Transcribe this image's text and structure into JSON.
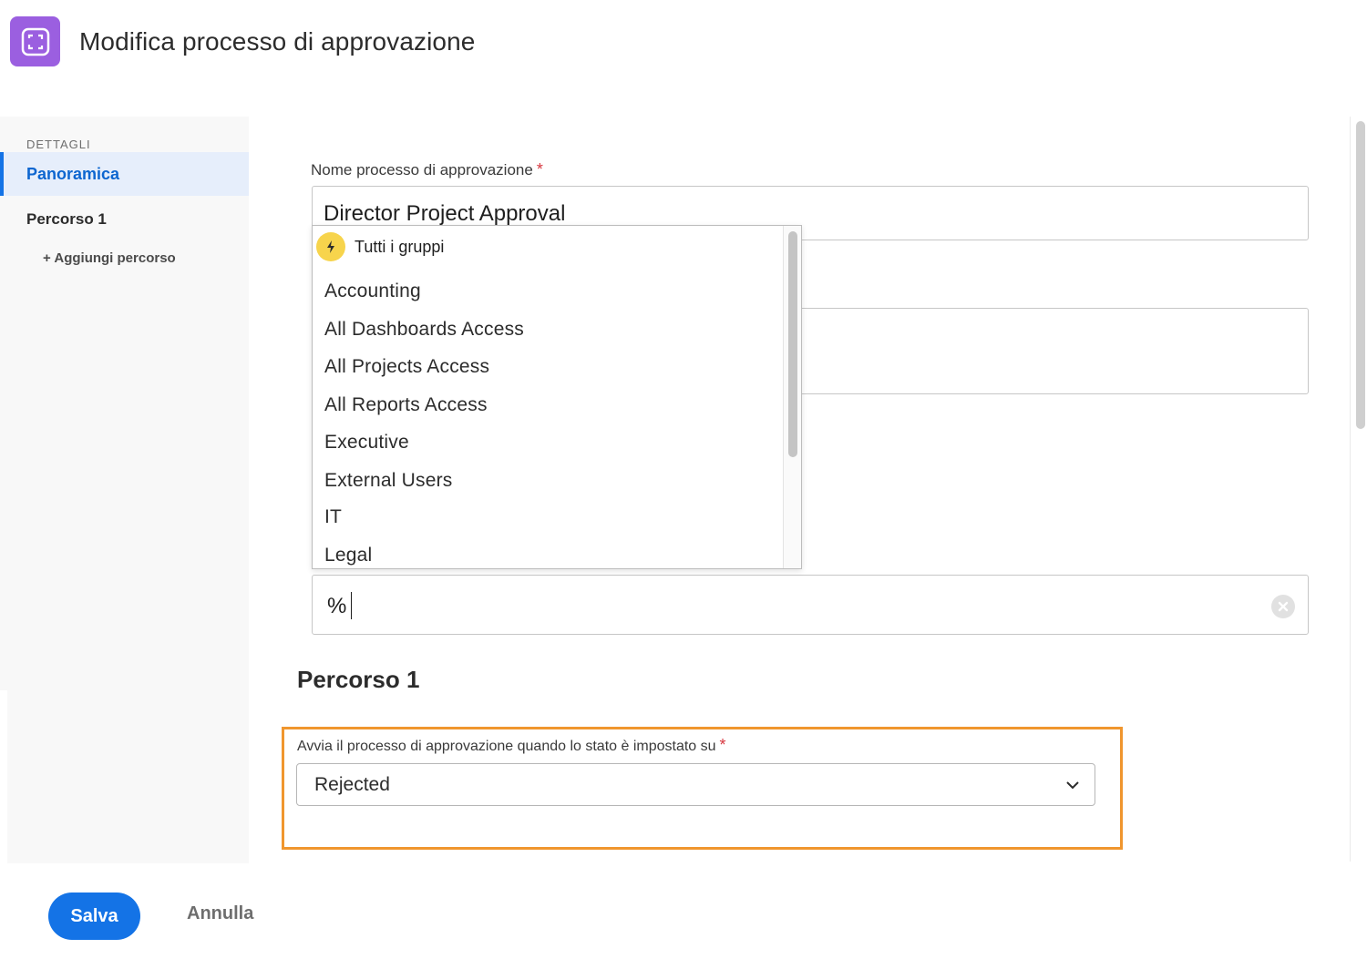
{
  "header": {
    "title": "Modifica processo di approvazione",
    "icon": "approval-process-icon",
    "accent": "#9b5fe0"
  },
  "sidebar": {
    "heading": "DETTAGLI",
    "items": [
      {
        "label": "Panoramica",
        "active": true
      },
      {
        "label": "Percorso 1",
        "active": false
      }
    ],
    "add_label": "+ Aggiungi percorso"
  },
  "form": {
    "name_label": "Nome processo di approvazione",
    "name_value": "Director Project Approval",
    "required_mark": "*",
    "group_search_value": "%",
    "dropdown": {
      "all_label": "Tutti i gruppi",
      "options": [
        "Accounting",
        "All Dashboards Access",
        "All Projects Access",
        "All Reports Access",
        "Executive",
        "External Users",
        "IT",
        "Legal"
      ]
    },
    "section_title": "Percorso 1",
    "status_label": "Avvia il processo di approvazione quando lo stato è impostato su",
    "status_value": "Rejected"
  },
  "footer": {
    "save_label": "Salva",
    "cancel_label": "Annulla"
  },
  "colors": {
    "primary": "#1473e6",
    "highlight": "#f0962e",
    "required": "#d7373f"
  }
}
